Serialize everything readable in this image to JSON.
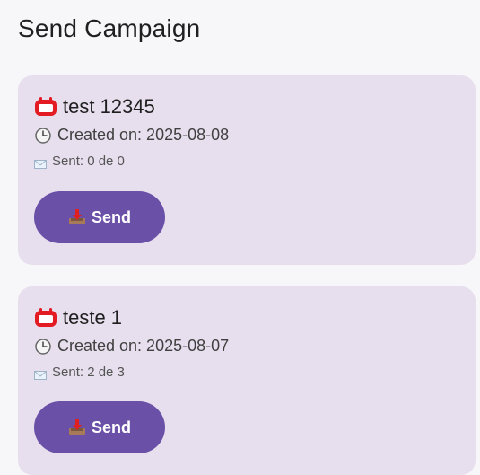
{
  "page": {
    "title": "Send Campaign"
  },
  "campaigns": [
    {
      "title": "test 12345",
      "created": "Created on: 2025-08-08",
      "sent": "Sent: 0 de 0",
      "button_label": "Send"
    },
    {
      "title": "teste 1",
      "created": "Created on: 2025-08-07",
      "sent": "Sent: 2 de 3",
      "button_label": "Send"
    }
  ],
  "icons": {
    "campaign": "calendar-icon",
    "created": "clock-icon",
    "sent": "envelope-icon",
    "send": "inbox-tray-icon"
  },
  "colors": {
    "card_background": "#e7dfee",
    "button_background": "#6b50a8",
    "page_background": "#f7f6f8"
  }
}
